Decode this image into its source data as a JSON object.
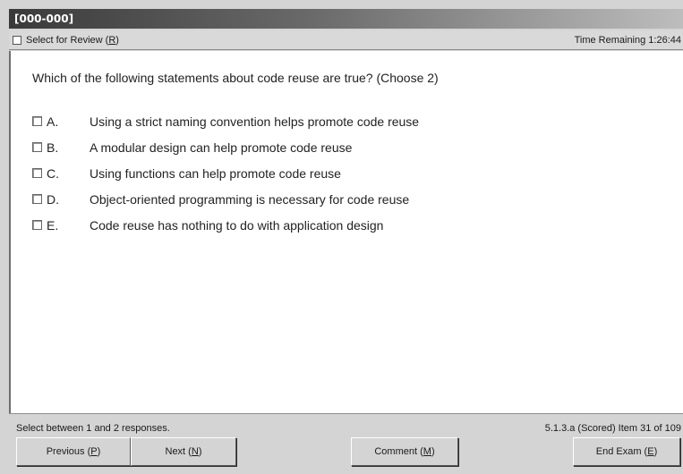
{
  "window": {
    "title": "[000-000]"
  },
  "toolbar": {
    "review_label": "Select for Review",
    "review_key": "R",
    "time_label": "Time Remaining 1:26:44"
  },
  "question": {
    "text": "Which of the following statements about code reuse are true? (Choose 2)",
    "options": [
      {
        "letter": "A.",
        "text": "Using a strict naming convention helps promote code reuse"
      },
      {
        "letter": "B.",
        "text": "A modular design can help promote code reuse"
      },
      {
        "letter": "C.",
        "text": "Using functions can help promote code reuse"
      },
      {
        "letter": "D.",
        "text": "Object-oriented programming is necessary for code reuse"
      },
      {
        "letter": "E.",
        "text": "Code reuse has nothing to do with application design"
      }
    ]
  },
  "footer": {
    "instructions": "Select between 1 and 2 responses.",
    "item_info": "5.1.3.a  (Scored)   Item 31 of 109",
    "buttons": {
      "previous": {
        "label": "Previous",
        "key": "P"
      },
      "next": {
        "label": "Next",
        "key": "N"
      },
      "comment": {
        "label": "Comment",
        "key": "M"
      },
      "end": {
        "label": "End Exam",
        "key": "E"
      }
    }
  }
}
